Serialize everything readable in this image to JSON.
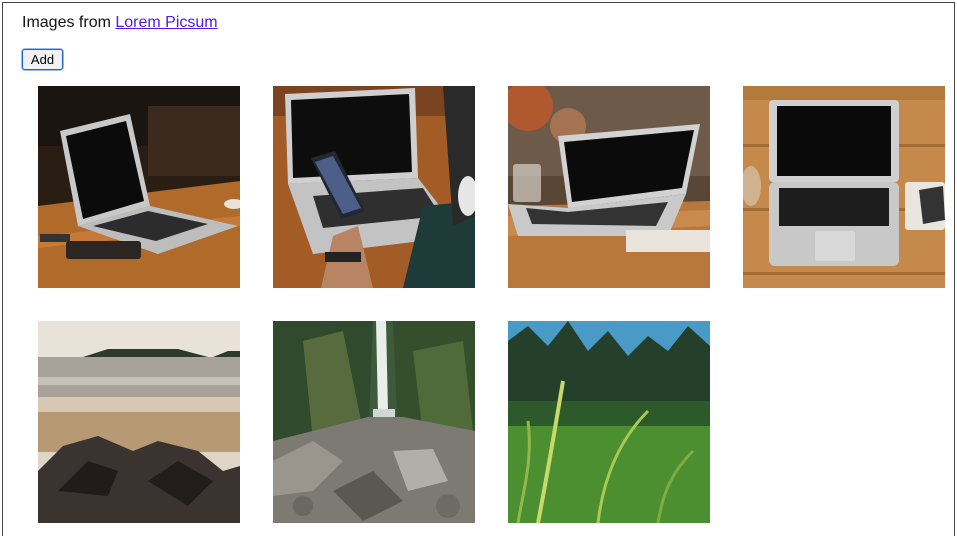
{
  "header": {
    "prefix": "Images from ",
    "link_text": "Lorem Picsum"
  },
  "toolbar": {
    "add_label": "Add"
  },
  "gallery": {
    "images": [
      {
        "icon": "laptop-photo",
        "subject": "laptop on wooden table"
      },
      {
        "icon": "laptop-photo",
        "subject": "hand with phone over laptop"
      },
      {
        "icon": "laptop-photo",
        "subject": "laptop on table"
      },
      {
        "icon": "laptop-photo",
        "subject": "laptop top view"
      },
      {
        "icon": "landscape-photo",
        "subject": "beach with rocks"
      },
      {
        "icon": "landscape-photo",
        "subject": "waterfall in rocky forest"
      },
      {
        "icon": "landscape-photo",
        "subject": "grass and trees"
      }
    ]
  }
}
